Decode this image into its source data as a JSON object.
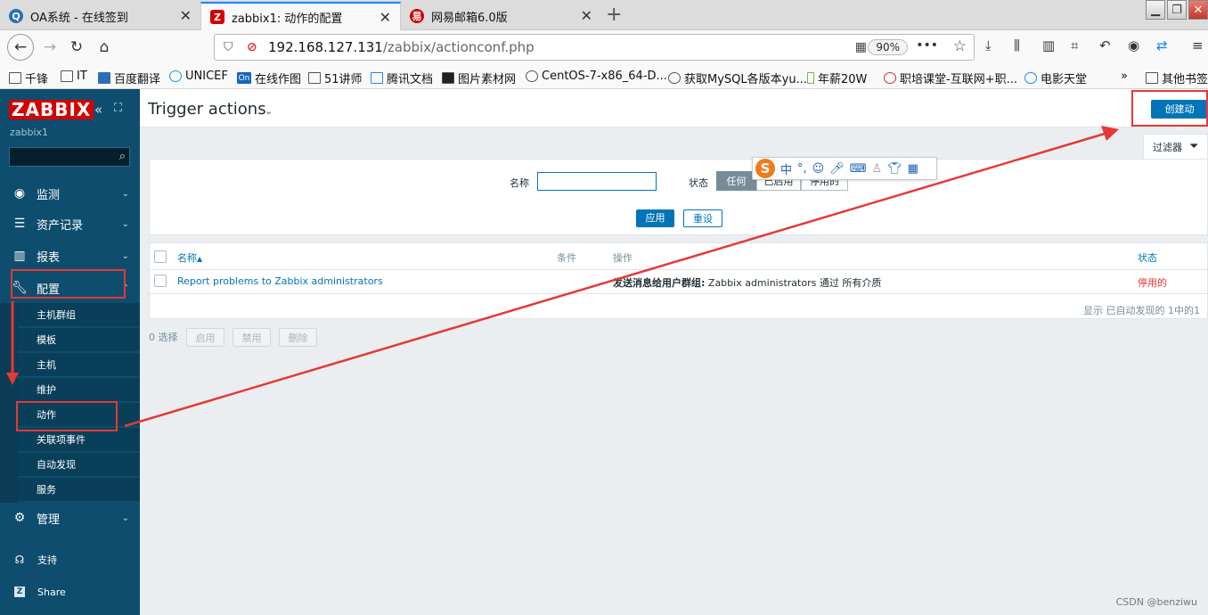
{
  "browser": {
    "tabs": [
      {
        "title": "OA系统 - 在线签到",
        "icon": "oa-icon",
        "color": "#2b6fb6"
      },
      {
        "title": "zabbix1: 动作的配置",
        "icon": "zabbix-z-icon",
        "color": "#d40000"
      },
      {
        "title": "网易邮箱6.0版",
        "icon": "netease-mail-icon",
        "color": "#d40000"
      }
    ],
    "url_host": "192.168.127.131",
    "url_path": "/zabbix/actionconf.php",
    "zoom": "90%",
    "bookmarks": [
      "千锋",
      "IT",
      "百度翻译",
      "UNICEF",
      "在线作图",
      "51讲师",
      "腾讯文档",
      "图片素材网",
      "CentOS-7-x86_64-D...",
      "获取MySQL各版本yu...",
      "年薪20W",
      "职培课堂-互联网+职...",
      "电影天堂",
      "其他书签"
    ]
  },
  "sidebar": {
    "logo": "ZABBIX",
    "server_name": "zabbix1",
    "menu": [
      {
        "label": "监测",
        "icon": "eye-icon"
      },
      {
        "label": "资产记录",
        "icon": "list-icon"
      },
      {
        "label": "报表",
        "icon": "bar-chart-icon"
      },
      {
        "label": "配置",
        "icon": "wrench-icon"
      }
    ],
    "submenu": [
      "主机群组",
      "模板",
      "主机",
      "维护",
      "动作",
      "关联项事件",
      "自动发现",
      "服务"
    ],
    "admin": {
      "label": "管理",
      "icon": "gear-icon"
    },
    "footer": [
      {
        "label": "支持",
        "icon": "headset-icon"
      },
      {
        "label": "Share",
        "icon": "share-z-icon"
      }
    ]
  },
  "main": {
    "title": "Trigger actions",
    "create_button": "创建动作",
    "filter_tab": "过滤器",
    "filter": {
      "name_label": "名称",
      "status_label": "状态",
      "status_options": [
        "任何",
        "已启用",
        "停用的"
      ],
      "apply": "应用",
      "reset": "重设"
    },
    "table": {
      "headers": {
        "name": "名称",
        "conditions": "条件",
        "operations": "操作",
        "status": "状态"
      },
      "sort_indicator": "▲",
      "rows": [
        {
          "name": "Report problems to Zabbix administrators",
          "conditions": "",
          "operation_bold": "发送消息给用户群组:",
          "operation_rest": " Zabbix administrators 通过 所有介质",
          "status": "停用的"
        }
      ],
      "footer": "显示 已自动发现的 1中的1"
    },
    "bulk": {
      "selected": "0 选择",
      "buttons": [
        "启用",
        "禁用",
        "删除"
      ]
    }
  },
  "ime": {
    "mode": "中",
    "punct": "°,"
  },
  "watermark": "CSDN @benziwu",
  "colors": {
    "sidebar": "#0e4d6e",
    "accent": "#0275b8",
    "danger": "#e33734",
    "logo": "#d40000",
    "annotation": "#e53935"
  }
}
